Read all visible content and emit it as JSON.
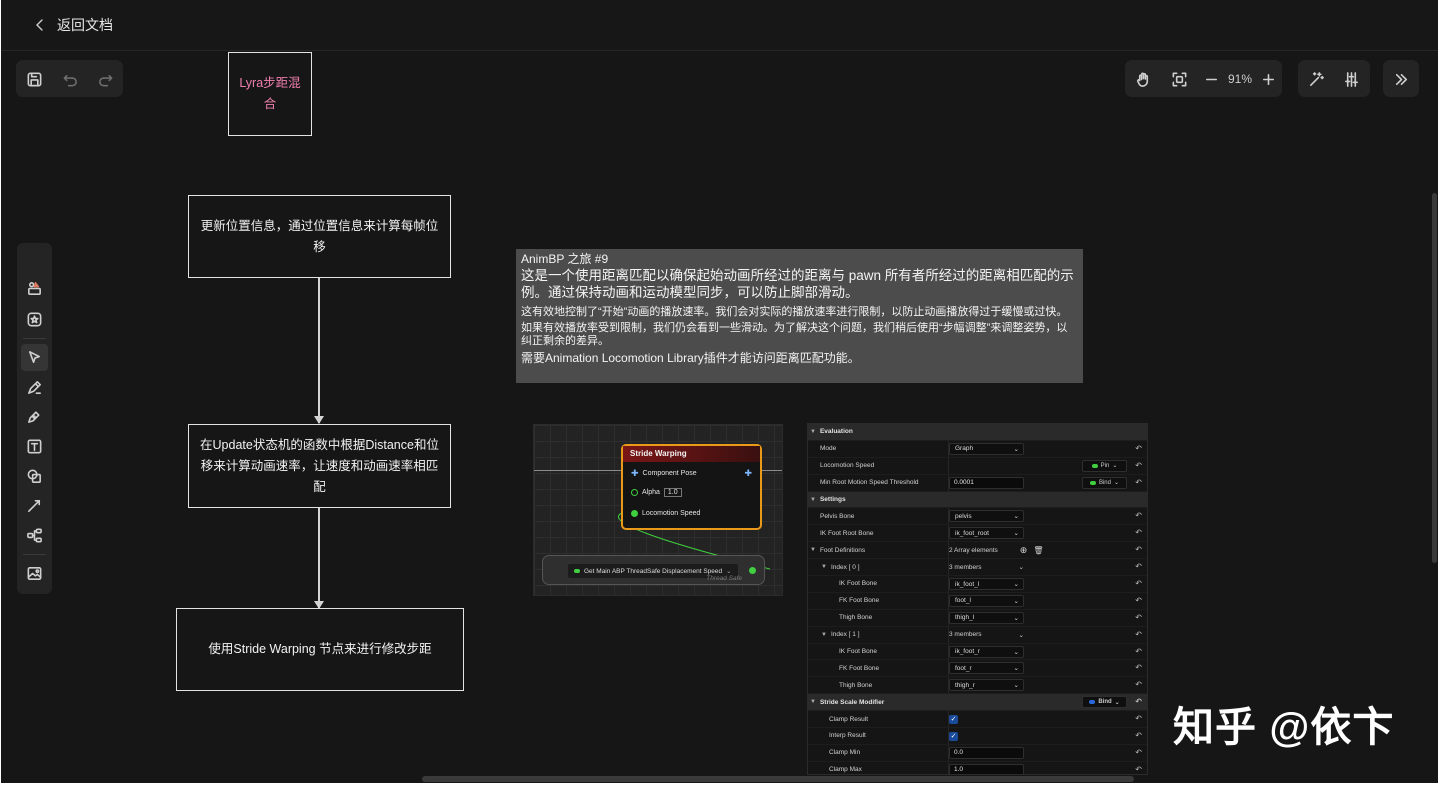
{
  "topbar": {
    "back_label": "返回文档"
  },
  "toolbar": {
    "zoom": "91%"
  },
  "canvas": {
    "title_box": "Lyra步距混合",
    "flow": [
      "更新位置信息，通过位置信息来计算每帧位移",
      "在Update状态机的函数中根据Distance和位移来计算动画速率，让速度和动画速率相匹配",
      "使用Stride Warping 节点来进行修改步距"
    ]
  },
  "comment": {
    "line1": "AnimBP 之旅 #9",
    "line2": "这是一个使用距离匹配以确保起始动画所经过的距离与 pawn 所有者所经过的距离相匹配的示例。通过保持动画和运动模型同步，可以防止脚部滑动。",
    "line3": "这有效地控制了“开始”动画的播放速率。我们会对实际的播放速率进行限制，以防止动画播放得过于缓慢或过快。",
    "line4": "如果有效播放率受到限制，我们仍会看到一些滑动。为了解决这个问题，我们稍后使用“步幅调整”来调整姿势，以纠正剩余的差异。",
    "line5": "需要Animation Locomotion Library插件才能访问距离匹配功能。"
  },
  "graph": {
    "node_title": "Stride Warping",
    "pin_pose": "Component Pose",
    "pin_alpha": "Alpha",
    "alpha_value": "1.0",
    "pin_speed": "Locomotion Speed",
    "get_node": "Get Main ABP ThreadSafe Displacement Speed",
    "thread_safe": "Thread Safe"
  },
  "details": [
    {
      "type": "cat",
      "label": "Evaluation"
    },
    {
      "type": "dd",
      "label": "Mode",
      "value": "Graph"
    },
    {
      "type": "bind",
      "label": "Locomotion Speed",
      "bind": "Pin",
      "dot": "green"
    },
    {
      "type": "txtbind",
      "label": "Min Root Motion Speed Threshold",
      "value": "0.0001",
      "bind": "Bind",
      "dot": "green"
    },
    {
      "type": "cat",
      "label": "Settings"
    },
    {
      "type": "dd",
      "label": "Pelvis Bone",
      "value": "pelvis"
    },
    {
      "type": "dd",
      "label": "IK Foot Root Bone",
      "value": "ik_foot_root"
    },
    {
      "type": "arr",
      "label": "Foot Definitions",
      "value": "2 Array elements"
    },
    {
      "type": "idx",
      "label": "Index [ 0 ]",
      "value": "3 members"
    },
    {
      "type": "dd2",
      "label": "IK Foot Bone",
      "value": "ik_foot_l"
    },
    {
      "type": "dd2",
      "label": "FK Foot Bone",
      "value": "foot_l"
    },
    {
      "type": "dd2",
      "label": "Thigh Bone",
      "value": "thigh_l"
    },
    {
      "type": "idx",
      "label": "Index [ 1 ]",
      "value": "3 members"
    },
    {
      "type": "dd2",
      "label": "IK Foot Bone",
      "value": "ik_foot_r"
    },
    {
      "type": "dd2",
      "label": "FK Foot Bone",
      "value": "foot_r"
    },
    {
      "type": "dd2",
      "label": "Thigh Bone",
      "value": "thigh_r"
    },
    {
      "type": "bindcat",
      "label": "Stride Scale Modifier",
      "bind": "Bind",
      "dot": "blue"
    },
    {
      "type": "chk",
      "label": "Clamp Result"
    },
    {
      "type": "chk",
      "label": "Interp Result"
    },
    {
      "type": "txt",
      "label": "Clamp Min",
      "value": "0.0"
    },
    {
      "type": "txt",
      "label": "Clamp Max",
      "value": "1.0"
    }
  ],
  "watermark": "知乎 @依卞"
}
